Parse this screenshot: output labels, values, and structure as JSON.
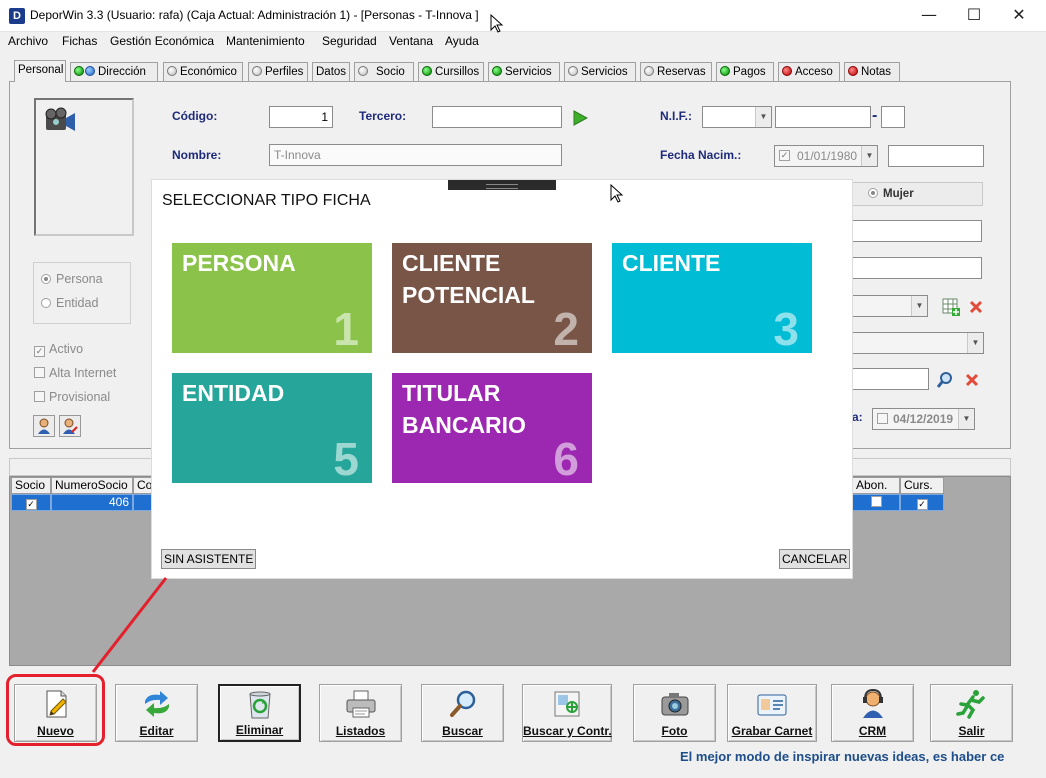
{
  "window": {
    "title": "DeporWin 3.3  (Usuario: rafa)  (Caja Actual: Administración 1) - [Personas - T-Innova  ]",
    "app_icon_letter": "D",
    "minimize": "—",
    "maximize": "☐",
    "close": "✕"
  },
  "menu": [
    "Archivo",
    "Fichas",
    "Gestión Económica",
    "Mantenimiento",
    "Seguridad",
    "Ventana",
    "Ayuda"
  ],
  "tabs": [
    {
      "label": "Personal",
      "dot": ""
    },
    {
      "label": "Dirección",
      "dot": "blue"
    },
    {
      "label": "Económico",
      "dot": "gray"
    },
    {
      "label": "Perfiles",
      "dot": "gray"
    },
    {
      "label": "Datos",
      "dot": ""
    },
    {
      "label": "Socio",
      "dot": "gray"
    },
    {
      "label": "Cursillos",
      "dot": "green"
    },
    {
      "label": "Servicios",
      "dot": "green"
    },
    {
      "label": "Servicios",
      "dot": "gray"
    },
    {
      "label": "Reservas",
      "dot": "gray"
    },
    {
      "label": "Pagos",
      "dot": "green"
    },
    {
      "label": "Acceso",
      "dot": "red"
    },
    {
      "label": "Notas",
      "dot": "red"
    }
  ],
  "form": {
    "codigo_label": "Código:",
    "codigo_value": "1",
    "tercero_label": "Tercero:",
    "tercero_value": "",
    "nif_label": "N.I.F.:",
    "nif_separator": "-",
    "nombre_label": "Nombre:",
    "nombre_value": "T-Innova",
    "fecha_label": "Fecha Nacim.:",
    "fecha_value": "01/01/1980",
    "mujer_label": "Mujer",
    "persona_label": "Persona",
    "entidad_label": "Entidad",
    "activo_label": "Activo",
    "alta_internet_label": "Alta Internet",
    "provisional_label": "Provisional",
    "fecha2_label_fragment": "a:",
    "fecha2_value": "04/12/2019"
  },
  "grid": {
    "headers_left": [
      "Socio",
      "NumeroSocio",
      "Co"
    ],
    "headers_right": [
      "Abon.",
      "Curs."
    ],
    "row": {
      "numero_socio": "406"
    }
  },
  "modal": {
    "title": "SELECCIONAR TIPO FICHA",
    "tiles": [
      {
        "label": "PERSONA",
        "number": "1",
        "color": "#8bc34a"
      },
      {
        "label": "CLIENTE POTENCIAL",
        "number": "2",
        "color": "#795548"
      },
      {
        "label": "CLIENTE",
        "number": "3",
        "color": "#00bcd4"
      },
      {
        "label": "ENTIDAD",
        "number": "5",
        "color": "#26a69a"
      },
      {
        "label": "TITULAR BANCARIO",
        "number": "6",
        "color": "#9c27b0"
      }
    ],
    "sin_asistente": "SIN ASISTENTE",
    "cancelar": "CANCELAR"
  },
  "toolbar": [
    {
      "label": "Nuevo",
      "icon": "new-document-icon"
    },
    {
      "label": "Editar",
      "icon": "edit-arrows-icon"
    },
    {
      "label": "Eliminar",
      "icon": "recycle-bin-icon"
    },
    {
      "label": "Listados",
      "icon": "printer-icon"
    },
    {
      "label": "Buscar",
      "icon": "magnifier-icon"
    },
    {
      "label": "Buscar y Contr.",
      "icon": "search-card-icon"
    },
    {
      "label": "Foto",
      "icon": "camera-icon"
    },
    {
      "label": "Grabar Carnet",
      "icon": "id-card-icon"
    },
    {
      "label": "CRM",
      "icon": "headset-person-icon"
    },
    {
      "label": "Salir",
      "icon": "running-man-icon"
    }
  ],
  "status_marquee": "El mejor modo de inspirar nuevas ideas, es haber ce",
  "accent_colors": {
    "highlight": "#e3202c",
    "label_blue": "#1e2a7a",
    "selection": "#1f6fd0"
  }
}
